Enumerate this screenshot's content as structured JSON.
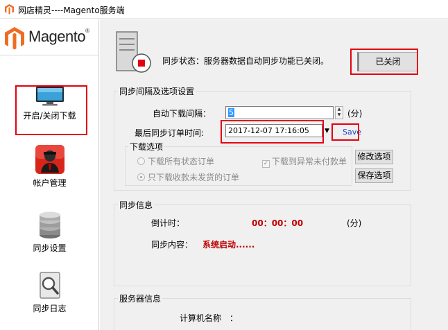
{
  "window": {
    "title": "网店精灵----Magento服务端"
  },
  "logo": {
    "text": "Magento",
    "reg": "®"
  },
  "sidebar": {
    "items": [
      {
        "label": "开启/关闭下载"
      },
      {
        "label": "帐户管理"
      },
      {
        "label": "同步设置"
      },
      {
        "label": "同步日志"
      }
    ]
  },
  "status": {
    "text": "同步状态：服务器数据自动同步功能已关闭。",
    "button_label": "已关闭"
  },
  "sync_settings": {
    "group_title": "同步间隔及选项设置",
    "interval_label": "自动下载间隔：",
    "interval_value": "5",
    "interval_unit": "(分)",
    "last_sync_label": "最后同步订单时间:",
    "last_sync_value": "2017-12-07 17:16:05",
    "save_link": "Save",
    "download_options": {
      "title": "下载选项",
      "opt_all": "下载所有状态订单",
      "opt_unpaid": "下载到异常未付款单",
      "opt_paid": "只下载收款未发货的订单",
      "modify_button": "修改选项",
      "save_button": "保存选项"
    }
  },
  "sync_info": {
    "group_title": "同步信息",
    "countdown_label": "倒计时：",
    "countdown_value": "00：00：00",
    "countdown_unit": "(分)",
    "content_label": "同步内容：",
    "content_value": "系统启动......"
  },
  "server_info": {
    "group_title": "服务器信息",
    "computer_name_label": "计算机名称　："
  },
  "colors": {
    "highlight": "#e3000f",
    "accent_red": "#c00000",
    "magento_orange": "#ef6c22"
  }
}
